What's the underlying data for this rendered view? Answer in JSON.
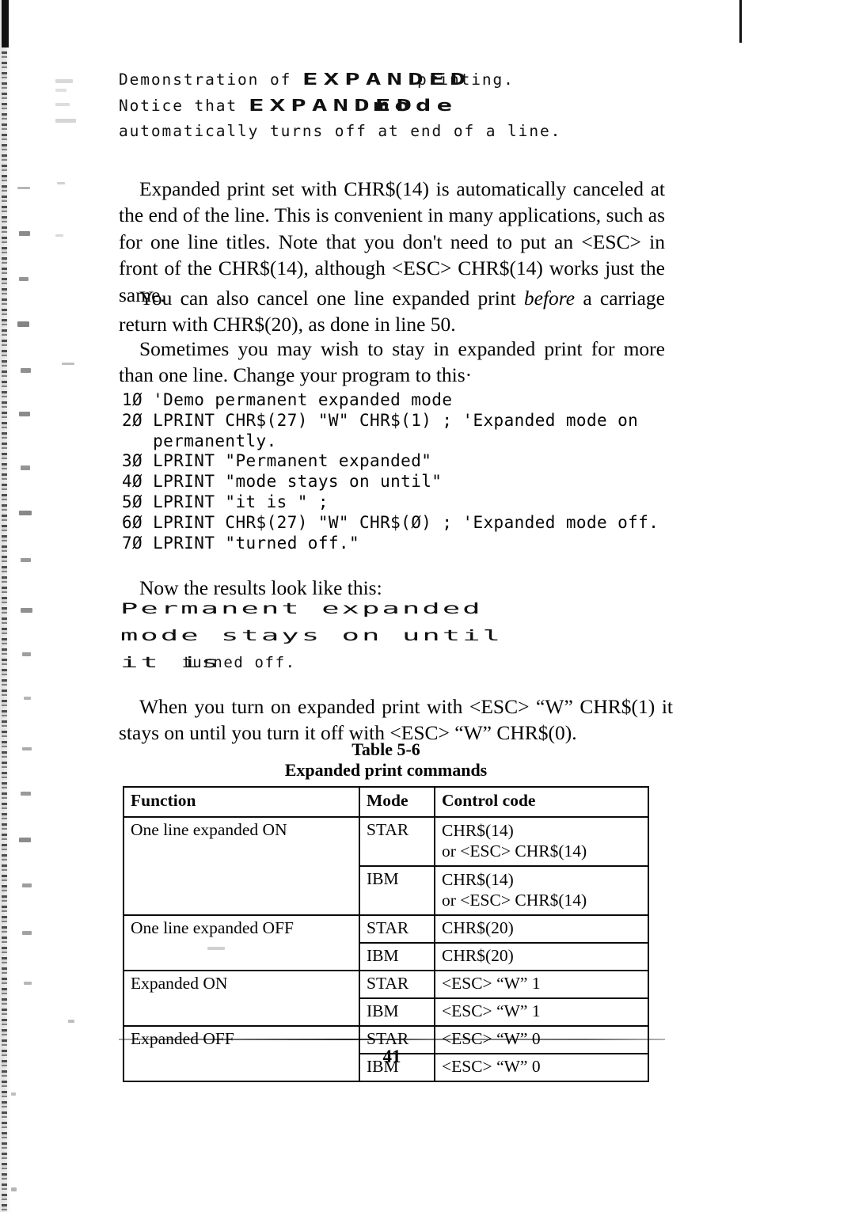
{
  "printout_header": {
    "line1_pre": "Demonstration of ",
    "line1_emph": "EXPANDED",
    "line1_post": " printing.",
    "line2_pre": "Notice that ",
    "line2_emph": "EXPANDED",
    "line2_post": " mode",
    "line3": "automatically turns off at end of a line."
  },
  "paragraphs": {
    "p1_a": "Expanded print set with CHR$(14) is automatically canceled at the end of the line.  This is convenient in many applications, such as for one line titles.  Note that you don't need to put an ",
    "p1_esc1": "<ESC>",
    "p1_b": " in front of the CHR$(14), although ",
    "p1_esc2": "<ESC>",
    "p1_c": " CHR$(14) works just the same.",
    "p2_a": "You can also cancel one line expanded print ",
    "p2_ital": "before",
    "p2_b": " a carriage return with CHR$(20), as done in line 50.",
    "p3": "Sometimes you may wish to stay in expanded print for more than one line. Change your program to this·",
    "p4": "Now the results look like this:",
    "p5_a": "When you turn on expanded print with ",
    "p5_esc1": "<ESC>",
    "p5_b": " “W” CHR$(1) it stays on until you turn it off with ",
    "p5_esc2": "<ESC>",
    "p5_c": " “W” CHR$(0)."
  },
  "code_listing": "1Ø 'Demo permanent expanded mode\n2Ø LPRINT CHR$(27) \"W\" CHR$(1) ; 'Expanded mode on\n   permanently.\n3Ø LPRINT \"Permanent expanded\"\n4Ø LPRINT \"mode stays on until\"\n5Ø LPRINT \"it is \" ;\n6Ø LPRINT CHR$(27) \"W\" CHR$(Ø) ; 'Expanded mode off.\n7Ø LPRINT \"turned off.\"",
  "printout_sample": {
    "line1": "Permanent expanded",
    "line2": "mode stays on until",
    "line3_wide": "it is ",
    "line3_norm": "turned off."
  },
  "table": {
    "caption_line1": "Table 5-6",
    "caption_line2": "Expanded print commands",
    "headers": [
      "Function",
      "Mode",
      "Control code"
    ],
    "rows": [
      {
        "function": "One line expanded ON",
        "modes": [
          {
            "mode": "STAR",
            "code_line1": "CHR$(14)",
            "code_line2_pre": "or  ",
            "code_line2_esc": "<ESC>",
            "code_line2_post": "  CHR$(14)"
          },
          {
            "mode": "IBM",
            "code_line1": "CHR$(14)",
            "code_line2_pre": "or  ",
            "code_line2_esc": "<ESC>",
            "code_line2_post": "  CHR$(14)"
          }
        ]
      },
      {
        "function": "One line expanded OFF",
        "modes": [
          {
            "mode": "STAR",
            "code_line1": "CHR$(20)"
          },
          {
            "mode": "IBM",
            "code_line1": "CHR$(20)"
          }
        ]
      },
      {
        "function": "Expanded ON",
        "modes": [
          {
            "mode": "STAR",
            "code_esc": "<ESC>",
            "code_post": "  “W” 1"
          },
          {
            "mode": "IBM",
            "code_esc": "<ESC>",
            "code_post": "  “W” 1"
          }
        ]
      },
      {
        "function": "Expanded OFF",
        "modes": [
          {
            "mode": "STAR",
            "code_esc": "<ESC>",
            "code_post": "  “W” 0"
          },
          {
            "mode": "IBM",
            "code_esc": "<ESC>",
            "code_post": "  “W” 0"
          }
        ]
      }
    ]
  },
  "footer": {
    "page_number": "41"
  }
}
